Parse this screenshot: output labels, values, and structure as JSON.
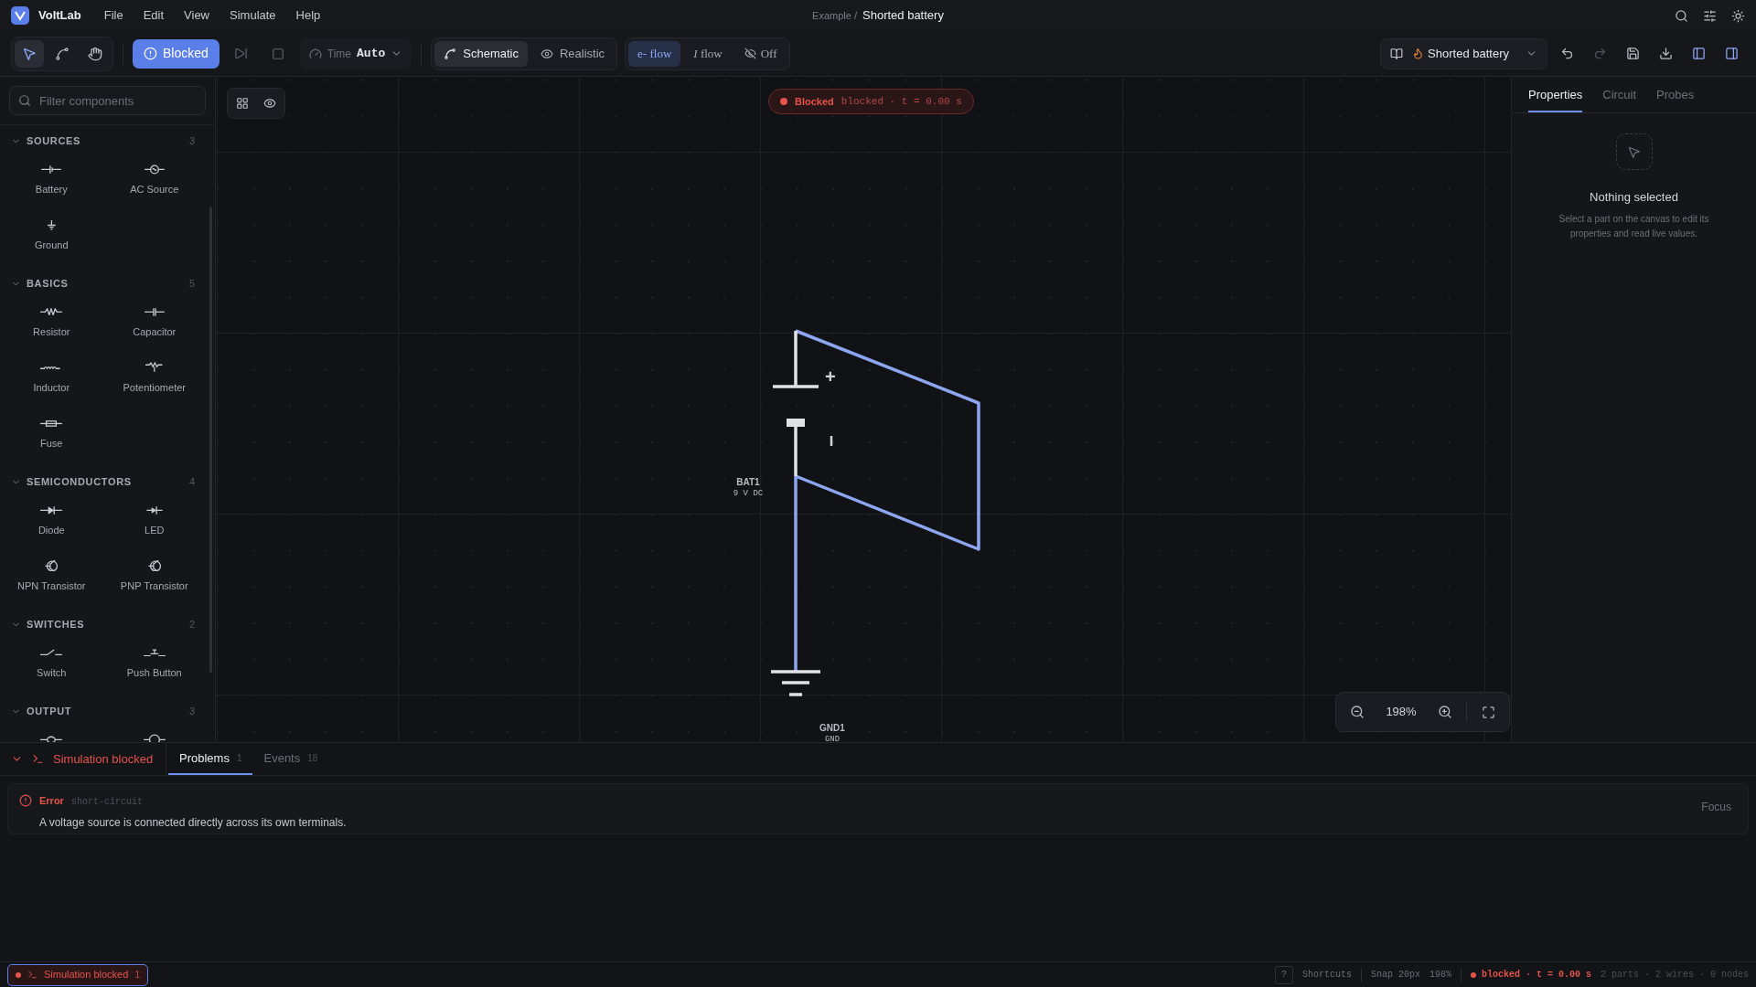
{
  "app": {
    "name": "VoltLab"
  },
  "menu": [
    "File",
    "Edit",
    "View",
    "Simulate",
    "Help"
  ],
  "breadcrumb": {
    "parent": "Example /",
    "current": "Shorted battery"
  },
  "tools": [
    {
      "kind": "pointer",
      "selected": true
    },
    {
      "kind": "wire",
      "selected": false
    },
    {
      "kind": "hand",
      "selected": false
    }
  ],
  "run_button": {
    "label": "Blocked"
  },
  "time": {
    "label": "Time",
    "value": "Auto"
  },
  "view_modes": [
    {
      "kind": "schematic",
      "label": "Schematic",
      "selected": true
    },
    {
      "kind": "realistic",
      "label": "Realistic",
      "selected": false
    }
  ],
  "flow_modes": [
    {
      "kind": "electron",
      "label": "e- flow",
      "selected": true
    },
    {
      "kind": "current",
      "label": "*I* flow",
      "selected": false
    },
    {
      "kind": "off",
      "label": "Off",
      "selected": false
    }
  ],
  "example_select": {
    "label": "Shorted battery"
  },
  "sidebar": {
    "search": {
      "placeholder": "Filter components"
    },
    "categories": [
      {
        "name": "SOURCES",
        "count": "3",
        "expanded": true,
        "items": [
          {
            "kind": "battery",
            "label": "Battery"
          },
          {
            "kind": "ac",
            "label": "AC Source"
          },
          {
            "kind": "ground",
            "label": "Ground"
          }
        ]
      },
      {
        "name": "BASICS",
        "count": "5",
        "expanded": true,
        "items": [
          {
            "kind": "resistor",
            "label": "Resistor"
          },
          {
            "kind": "capacitor",
            "label": "Capacitor"
          },
          {
            "kind": "inductor",
            "label": "Inductor"
          },
          {
            "kind": "potentiometer",
            "label": "Potentiometer"
          },
          {
            "kind": "fuse",
            "label": "Fuse"
          }
        ]
      },
      {
        "name": "SEMICONDUCTORS",
        "count": "4",
        "expanded": true,
        "items": [
          {
            "kind": "diode",
            "label": "Diode"
          },
          {
            "kind": "led",
            "label": "LED"
          },
          {
            "kind": "npn",
            "label": "NPN Transistor"
          },
          {
            "kind": "pnp",
            "label": "PNP Transistor"
          }
        ]
      },
      {
        "name": "SWITCHES",
        "count": "2",
        "expanded": true,
        "items": [
          {
            "kind": "switch",
            "label": "Switch"
          },
          {
            "kind": "pushbutton",
            "label": "Push Button"
          }
        ]
      },
      {
        "name": "OUTPUT",
        "count": "3",
        "expanded": true,
        "items": [
          {
            "kind": "lamp"
          },
          {
            "kind": "motor"
          }
        ]
      }
    ]
  },
  "canvas": {
    "status": {
      "label": "Blocked",
      "detail": "blocked · t = 0.00 s"
    },
    "parts": [
      {
        "kind": "battery",
        "name": "BAT1",
        "value": "9 V DC",
        "plus": "+"
      },
      {
        "kind": "ground",
        "name": "GND1",
        "value": "GND"
      }
    ],
    "zoom": "198%"
  },
  "inspector": {
    "tabs": [
      {
        "label": "Properties",
        "selected": true
      },
      {
        "label": "Circuit",
        "selected": false
      },
      {
        "label": "Probes",
        "selected": false
      }
    ],
    "empty_title": "Nothing selected",
    "empty_text": "Select a part on the canvas to edit its properties and read live values."
  },
  "console": {
    "title": "Simulation blocked",
    "expanded": true,
    "tabs": [
      {
        "label": "Problems",
        "count": "1",
        "selected": true
      },
      {
        "label": "Events",
        "count": "18",
        "selected": false
      }
    ],
    "problems": [
      {
        "level": "Error",
        "code": "short-circuit",
        "message": "A voltage source is connected directly across its own terminals.",
        "action": "Focus"
      }
    ]
  },
  "status_bar": {
    "chip": {
      "label": "Simulation blocked",
      "count": "1"
    },
    "help_key": "?",
    "shortcuts": "Shortcuts",
    "snap": "Snap 20px",
    "zoom": "198%",
    "sim": "blocked · t = 0.00 s",
    "stats": "2 parts · 2 wires · 0 nodes"
  }
}
